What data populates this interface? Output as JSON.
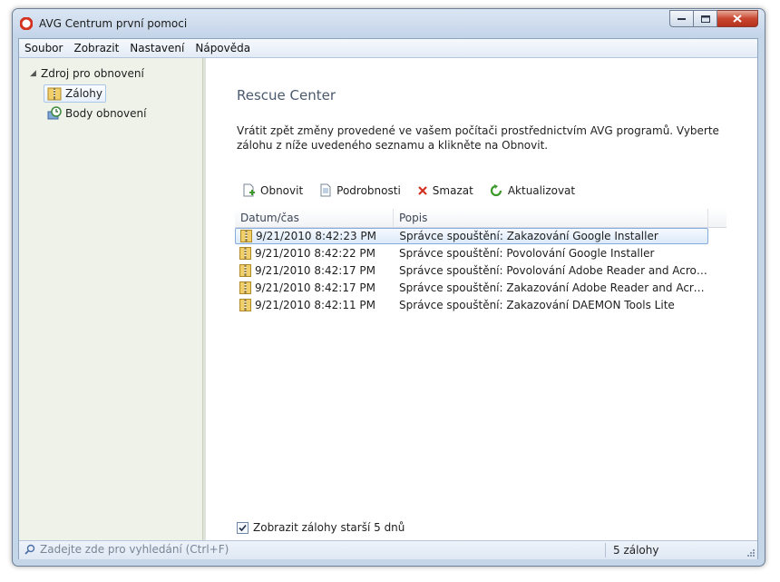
{
  "window": {
    "title": "AVG Centrum první pomoci",
    "icon": "avg-lifebuoy-icon"
  },
  "menu": {
    "items": [
      "Soubor",
      "Zobrazit",
      "Nastavení",
      "Nápověda"
    ]
  },
  "sidebar": {
    "root_label": "Zdroj pro obnovení",
    "items": [
      {
        "label": "Zálohy",
        "icon": "folder-zip-icon",
        "selected": true
      },
      {
        "label": "Body obnovení",
        "icon": "restore-point-icon",
        "selected": false
      }
    ]
  },
  "main": {
    "title": "Rescue Center",
    "description": "Vrátit zpět změny provedené ve vašem počítači prostřednictvím AVG programů. Vyberte zálohu z níže uvedeného seznamu a klikněte na Obnovit.",
    "toolbar": {
      "restore": "Obnovit",
      "details": "Podrobnosti",
      "delete": "Smazat",
      "refresh": "Aktualizovat"
    },
    "columns": {
      "date": "Datum/čas",
      "desc": "Popis"
    },
    "rows": [
      {
        "date": "9/21/2010 8:42:23 PM",
        "desc": "Správce spouštění: Zakazování Google Installer"
      },
      {
        "date": "9/21/2010 8:42:22 PM",
        "desc": "Správce spouštění: Povolování Google Installer"
      },
      {
        "date": "9/21/2010 8:42:17 PM",
        "desc": "Správce spouštění: Povolování Adobe Reader and Acrobat Ma..."
      },
      {
        "date": "9/21/2010 8:42:17 PM",
        "desc": "Správce spouštění: Zakazování Adobe Reader and Acrobat Ma..."
      },
      {
        "date": "9/21/2010 8:42:11 PM",
        "desc": "Správce spouštění: Zakazování DAEMON Tools Lite"
      }
    ],
    "selected_row": 0,
    "show_older_label": "Zobrazit zálohy starší 5 dnů",
    "show_older_checked": true
  },
  "status": {
    "search_placeholder": "Zadejte zde pro vyhledání (Ctrl+F)",
    "count": "5 zálohy"
  },
  "colors": {
    "selection_border": "#84acdd",
    "delete_red": "#d33020",
    "add_green": "#3c9a2c"
  }
}
